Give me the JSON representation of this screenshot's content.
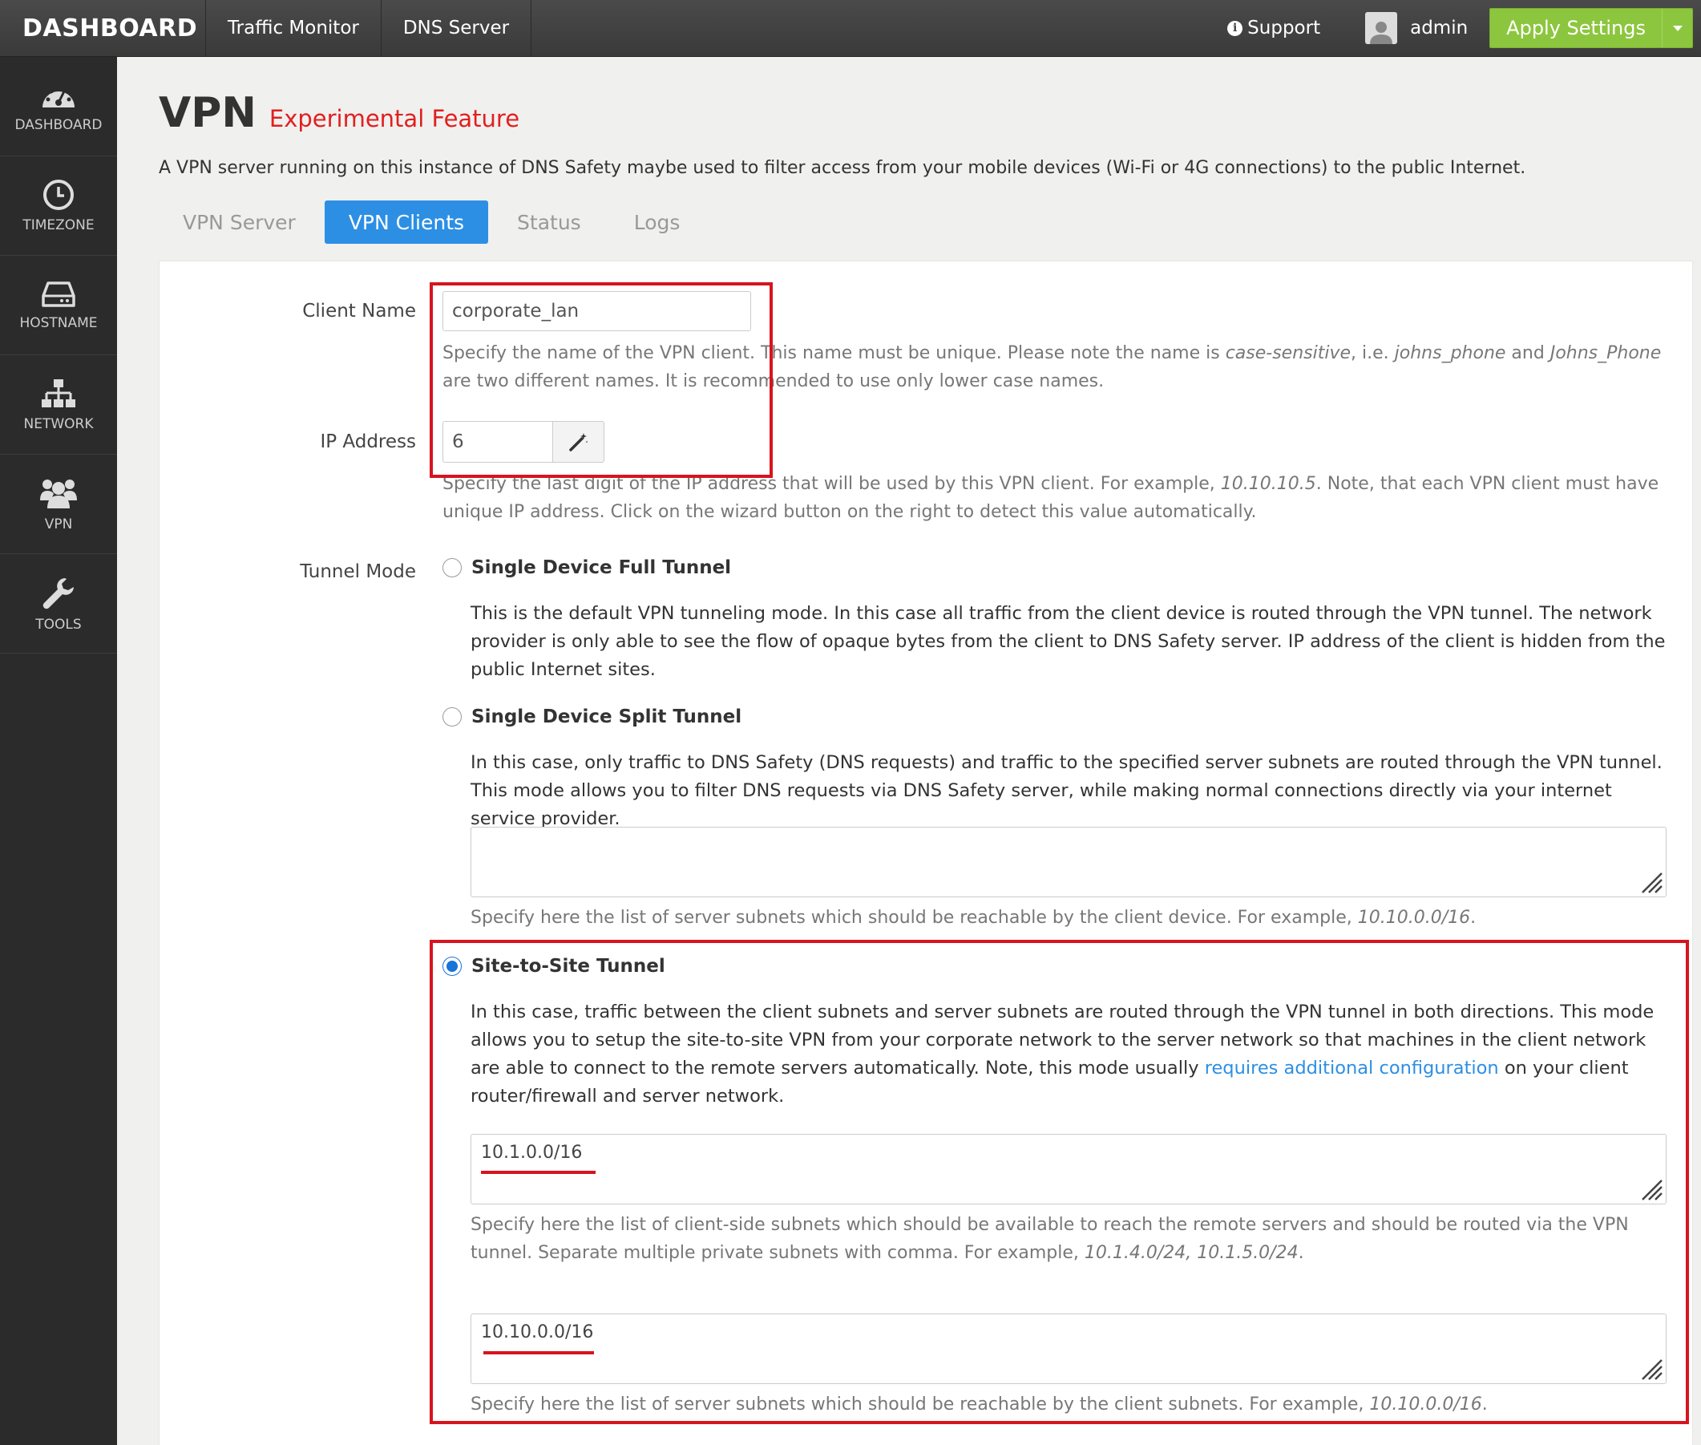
{
  "topbar": {
    "brand": "DASHBOARD",
    "nav": [
      "Traffic Monitor",
      "DNS Server"
    ],
    "support": "Support",
    "user": "admin",
    "apply": "Apply Settings"
  },
  "sidebar": {
    "items": [
      {
        "label": "DASHBOARD",
        "icon": "dashboard-gauge-icon"
      },
      {
        "label": "TIMEZONE",
        "icon": "clock-icon"
      },
      {
        "label": "HOSTNAME",
        "icon": "hard-drive-icon"
      },
      {
        "label": "NETWORK",
        "icon": "sitemap-icon"
      },
      {
        "label": "VPN",
        "icon": "users-icon"
      },
      {
        "label": "TOOLS",
        "icon": "wrench-icon"
      }
    ]
  },
  "page": {
    "title": "VPN",
    "badge": "Experimental Feature",
    "description": "A VPN server running on this instance of DNS Safety maybe used to filter access from your mobile devices (Wi-Fi or 4G connections) to the public Internet."
  },
  "tabs": [
    {
      "label": "VPN Server",
      "active": false
    },
    {
      "label": "VPN Clients",
      "active": true
    },
    {
      "label": "Status",
      "active": false
    },
    {
      "label": "Logs",
      "active": false
    }
  ],
  "form": {
    "client_name": {
      "label": "Client Name",
      "value": "corporate_lan",
      "help_1": "Specify the name of the VPN client. This name must be unique. Please note the name is ",
      "help_em_1": "case-sensitive",
      "help_2": ", i.e. ",
      "help_em_2": "johns_phone",
      "help_3": " and ",
      "help_em_3": "Johns_Phone",
      "help_4": " are two different names. It is recommended to use only lower case names."
    },
    "ip_address": {
      "label": "IP Address",
      "value": "6",
      "help_1": "Specify the last digit of the IP address that will be used by this VPN client. For example, ",
      "help_em_1": "10.10.10.5",
      "help_2": ". Note, that each VPN client must have unique IP address. Click on the wizard button on the right to detect this value automatically."
    },
    "tunnel_mode": {
      "label": "Tunnel Mode",
      "full": {
        "label": "Single Device Full Tunnel",
        "checked": false,
        "description": "This is the default VPN tunneling mode. In this case all traffic from the client device is routed through the VPN tunnel. The network provider is only able to see the flow of opaque bytes from the client to DNS Safety server. IP address of the client is hidden from the public Internet sites."
      },
      "split": {
        "label": "Single Device Split Tunnel",
        "checked": false,
        "description": "In this case, only traffic to DNS Safety (DNS requests) and traffic to the specified server subnets are routed through the VPN tunnel. This mode allows you to filter DNS requests via DNS Safety server, while making normal connections directly via your internet service provider.",
        "subnets_value": "",
        "help_1": "Specify here the list of server subnets which should be reachable by the client device. For example, ",
        "help_em_1": "10.10.0.0/16",
        "help_2": "."
      },
      "site": {
        "label": "Site-to-Site Tunnel",
        "checked": true,
        "description_1": "In this case, traffic between the client subnets and server subnets are routed through the VPN tunnel in both directions. This mode allows you to setup the site-to-site VPN from your corporate network to the server network so that machines in the client network are able to connect to the remote servers automatically. Note, this mode usually ",
        "link": "requires additional configuration",
        "description_2": " on your client router/firewall and server network.",
        "client_subnets_value": "10.1.0.0/16",
        "client_help_1": "Specify here the list of client-side subnets which should be available to reach the remote servers and should be routed via the VPN tunnel. Separate multiple private subnets with comma. For example, ",
        "client_help_em_1": "10.1.4.0/24, 10.1.5.0/24",
        "client_help_2": ".",
        "server_subnets_value": "10.10.0.0/16",
        "server_help_1": "Specify here the list of server subnets which should be reachable by the client subnets. For example, ",
        "server_help_em_1": "10.10.0.0/16",
        "server_help_2": "."
      }
    }
  },
  "colors": {
    "accent": "#2c8fe4",
    "apply": "#8cc63e",
    "experimental": "#e0201f",
    "highlight": "#d7141e"
  }
}
